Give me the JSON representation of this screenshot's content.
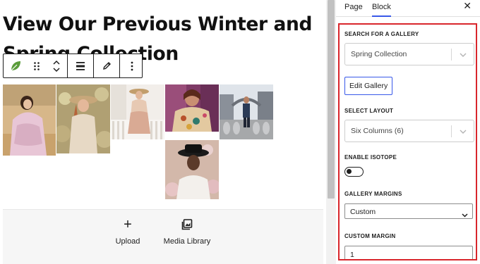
{
  "editor": {
    "heading": "View Our Previous Winter and Spring Collection",
    "toolbar": {
      "block_icon": "leaf-icon",
      "drag_icon": "drag-handle-icon",
      "move_icon": "chevron-up-down-icon",
      "align_icon": "align-justify-icon",
      "edit_icon": "pencil-icon",
      "options_icon": "vertical-ellipsis-icon"
    },
    "gallery": {
      "photos": [
        "photo-1",
        "photo-2",
        "photo-3",
        "photo-4",
        "photo-5",
        "photo-6"
      ]
    },
    "placeholder": {
      "upload_glyph": "+",
      "upload_label": "Upload",
      "media_label": "Media Library"
    }
  },
  "sidebar": {
    "tabs": [
      "Page",
      "Block"
    ],
    "active_tab": "Block",
    "close_glyph": "✕",
    "search_gallery": {
      "label": "SEARCH FOR A GALLERY",
      "value": "Spring Collection"
    },
    "edit_gallery_label": "Edit Gallery",
    "select_layout": {
      "label": "SELECT LAYOUT",
      "value": "Six Columns (6)"
    },
    "isotope": {
      "label": "ENABLE ISOTOPE",
      "enabled": false
    },
    "gallery_margins": {
      "label": "GALLERY MARGINS",
      "value": "Custom"
    },
    "custom_margin": {
      "label": "CUSTOM MARGIN",
      "value": "1"
    }
  },
  "colors": {
    "accent": "#3858e9",
    "highlight": "#d9262c",
    "leaf": "#5a9c3a"
  }
}
